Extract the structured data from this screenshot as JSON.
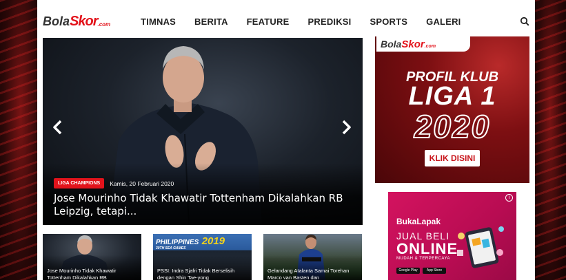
{
  "header": {
    "logo": {
      "part1": "Bola",
      "part2": "Skor",
      "part3": ".com"
    },
    "nav": [
      "TIMNAS",
      "BERITA",
      "FEATURE",
      "PREDIKSI",
      "SPORTS",
      "GALERI"
    ]
  },
  "hero": {
    "category": "LIGA CHAMPIONS",
    "date": "Kamis, 20 Februari 2020",
    "title": "Jose Mourinho Tidak Khawatir Tottenham Dikalahkan RB Leipzig, tetapi..."
  },
  "ad_bolaskor": {
    "logo": {
      "part1": "Bola",
      "part2": "Skor",
      "part3": ".com"
    },
    "line1": "PROFIL KLUB",
    "line2": "LIGA 1",
    "line3": "2020",
    "button": "KLIK DISINI"
  },
  "ad_bukalapak": {
    "brand": "BukaLapak",
    "line1": "JUAL BELI",
    "line2": "ONLINE",
    "line3": "MUDAH & TERPERCAYA",
    "store1": "Google Play",
    "store2": "App Store"
  },
  "thumbnails": [
    {
      "title": "Jose Mourinho Tidak Khawatir Tottenham Dikalahkan RB",
      "banner": null
    },
    {
      "title": "PSSI: Indra Sjafri Tidak Berselisih dengan Shin Tae-yong",
      "banner": {
        "b1": "PHILIPPINES",
        "b2": "2019",
        "b3": "30TH SEA GAMES"
      }
    },
    {
      "title": "Gelandang Atalanta Samai Torehan Marco van Basten dan",
      "banner": null
    }
  ],
  "colors": {
    "brand_red": "#e3131b",
    "bukalapak_pink": "#d3135f"
  }
}
